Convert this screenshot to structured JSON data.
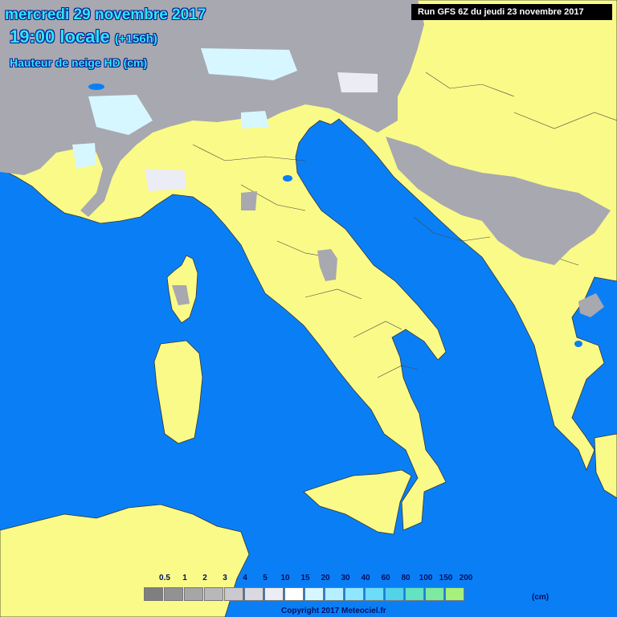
{
  "header": {
    "date_line": "mercredi 29 novembre 2017",
    "time_line": "19:00 locale",
    "offset": "(+156h)",
    "field_title": "Hauteur de neige HD (cm)"
  },
  "run_info": "Run GFS 6Z du jeudi 23 novembre 2017",
  "legend": {
    "unit": "(cm)",
    "entries": [
      {
        "label": "0.5",
        "color": "#7f7f7f"
      },
      {
        "label": "1",
        "color": "#929292"
      },
      {
        "label": "2",
        "color": "#a6a6a6"
      },
      {
        "label": "3",
        "color": "#b8b8b8"
      },
      {
        "label": "4",
        "color": "#c9c9cf"
      },
      {
        "label": "5",
        "color": "#d9d9e2"
      },
      {
        "label": "10",
        "color": "#ececf5"
      },
      {
        "label": "15",
        "color": "#ffffff"
      },
      {
        "label": "20",
        "color": "#d6f7ff"
      },
      {
        "label": "30",
        "color": "#b4f0ff"
      },
      {
        "label": "40",
        "color": "#8fe7ff"
      },
      {
        "label": "60",
        "color": "#6ddcf7"
      },
      {
        "label": "80",
        "color": "#52d4e8"
      },
      {
        "label": "100",
        "color": "#63e3c0"
      },
      {
        "label": "150",
        "color": "#7eeaa0"
      },
      {
        "label": "200",
        "color": "#a8f07c"
      }
    ]
  },
  "copyright": "Copyright 2017 Meteociel.fr",
  "colors": {
    "sea": "#0a7ff5",
    "land": "#fafa88",
    "snow_grey": "#a8a8b0",
    "border": "#3a3a3a"
  }
}
